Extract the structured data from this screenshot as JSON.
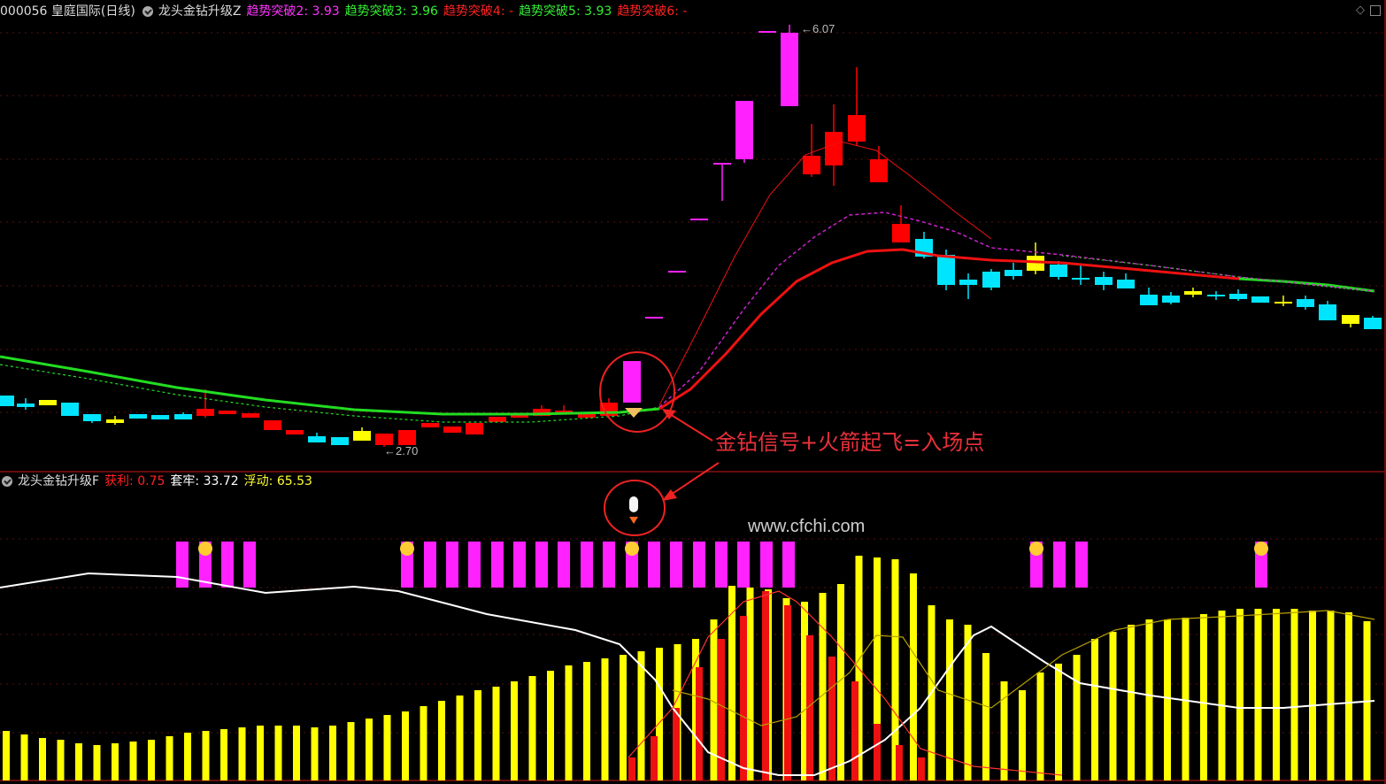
{
  "header_main": {
    "stock": "000056 皇庭国际(日线)",
    "indicator": "龙头金钻升级Z",
    "items": [
      {
        "label": "趋势突破2:",
        "value": "3.93",
        "color": "#ff33ff"
      },
      {
        "label": "趋势突破3:",
        "value": "3.96",
        "color": "#33ee33"
      },
      {
        "label": "趋势突破4:",
        "value": "-",
        "color": "#ff2222"
      },
      {
        "label": "趋势突破5:",
        "value": "3.93",
        "color": "#33ee33"
      },
      {
        "label": "趋势突破6:",
        "value": "-",
        "color": "#ff2222"
      }
    ]
  },
  "header_sub": {
    "indicator": "龙头金钻升级F",
    "items": [
      {
        "label": "获利:",
        "value": "0.75",
        "color": "#ff2222"
      },
      {
        "label": "套牢:",
        "value": "33.72",
        "color": "#ffffff"
      },
      {
        "label": "浮动:",
        "value": "65.53",
        "color": "#ffff33"
      }
    ]
  },
  "controls": {
    "diamond": "◇",
    "square_icon": "window-icon"
  },
  "labels": {
    "high_price": "6.07",
    "low_price": "2.70",
    "annotation": "金钻信号+火箭起飞=入场点",
    "watermark": "www.cfchi.com"
  },
  "colors": {
    "up_red": "#ff0000",
    "down_cyan": "#00e5ff",
    "limit_magenta": "#ff22ff",
    "doji_yellow": "#ffff00",
    "ma_green": "#22dd22",
    "ma_red": "#ee1111",
    "ma_purple": "#cc22cc"
  }
}
